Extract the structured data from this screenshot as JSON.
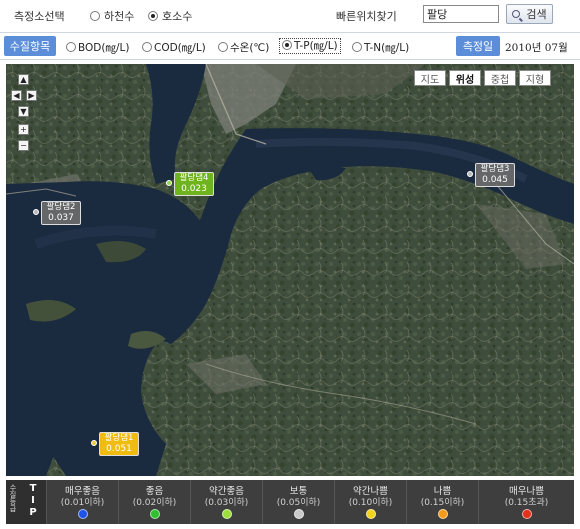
{
  "header": {
    "source_label": "측정소선택",
    "source_options": [
      {
        "label": "하천수",
        "selected": false
      },
      {
        "label": "호소수",
        "selected": true
      }
    ],
    "quick_search_label": "빠른위치찾기",
    "search_value": "팔당",
    "search_button": "검색"
  },
  "params": {
    "label": "수질항목",
    "options": [
      {
        "label": "BOD(㎎/L)",
        "selected": false
      },
      {
        "label": "COD(㎎/L)",
        "selected": false
      },
      {
        "label": "수온(℃)",
        "selected": false
      },
      {
        "label": "T-P(㎎/L)",
        "selected": true
      },
      {
        "label": "T-N(㎎/L)",
        "selected": false
      }
    ],
    "date_label": "측정일",
    "date_value": "2010년 07월"
  },
  "map": {
    "zoom_controls": {
      "up": "▲",
      "left": "◀",
      "right": "▶",
      "down": "▼",
      "zoom_in": "+",
      "zoom_out": "−"
    },
    "map_types": [
      {
        "label": "지도",
        "active": false
      },
      {
        "label": "위성",
        "active": true
      },
      {
        "label": "중첩",
        "active": false
      },
      {
        "label": "지형",
        "active": false
      }
    ],
    "stations": [
      {
        "name": "팔당댐2",
        "value": "0.037",
        "level": "gray"
      },
      {
        "name": "팔당댐4",
        "value": "0.023",
        "level": "green"
      },
      {
        "name": "팔당댐3",
        "value": "0.045",
        "level": "gray"
      },
      {
        "name": "팔당댐1",
        "value": "0.051",
        "level": "yellow"
      }
    ]
  },
  "legend": {
    "side_label": "수질등급",
    "tp_label": "T-P",
    "tp_letters": [
      "T",
      "I",
      "P"
    ],
    "items": [
      {
        "name": "매우좋음",
        "range": "(0.01이하)",
        "color": "#1f53e8"
      },
      {
        "name": "좋음",
        "range": "(0.02이하)",
        "color": "#2fbf2f"
      },
      {
        "name": "약간좋음",
        "range": "(0.03이하)",
        "color": "#9ede3a"
      },
      {
        "name": "보통",
        "range": "(0.05이하)",
        "color": "#c8c8c8"
      },
      {
        "name": "약간나쁨",
        "range": "(0.10이하)",
        "color": "#f2d21b"
      },
      {
        "name": "나쁨",
        "range": "(0.15이하)",
        "color": "#f49a1a"
      },
      {
        "name": "매우나쁨",
        "range": "(0.15초과)",
        "color": "#e4301d"
      }
    ]
  }
}
